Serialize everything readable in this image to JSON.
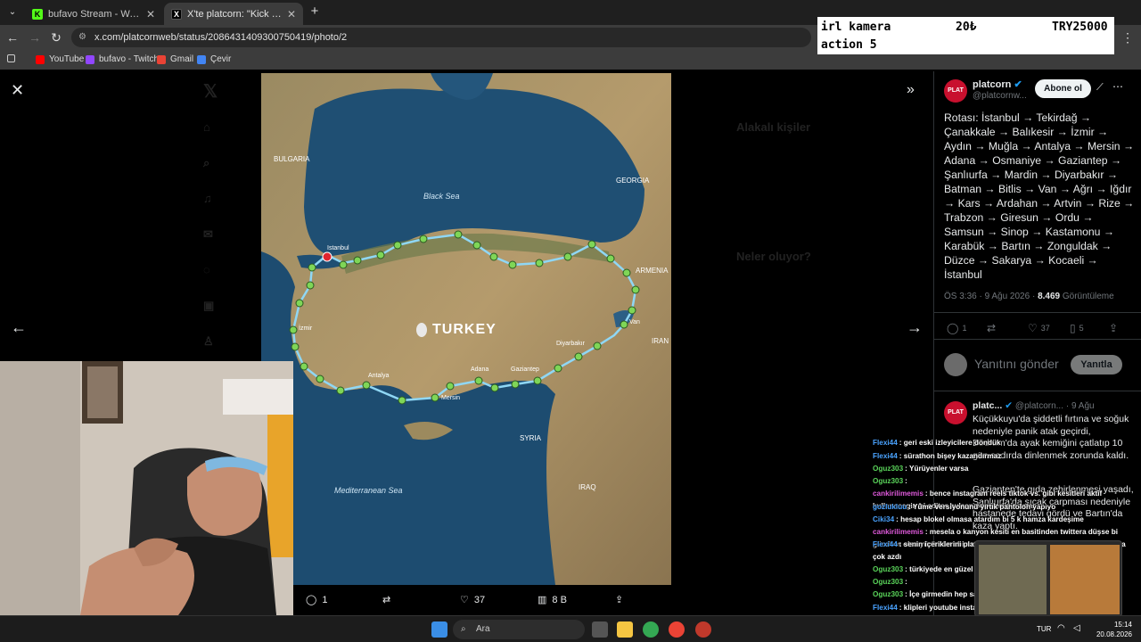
{
  "browser": {
    "tabs": [
      {
        "title": "bufavo Stream - Watch Live on",
        "favicon": "kick-icon",
        "active": false
      },
      {
        "title": "X'te platcorn: \"Kick yayıncısı Bu",
        "favicon": "x-icon",
        "active": true
      }
    ],
    "url": "x.com/platcornweb/status/2086431409300750419/photo/2",
    "bookmarks": [
      "YouTube",
      "bufavo - Twitch",
      "Gmail",
      "Çevir"
    ]
  },
  "stream_overlay": {
    "label_line1": "irl kamera",
    "label_line2": "action 5",
    "price": "20₺",
    "goal": "TRY25000"
  },
  "map": {
    "country": "TURKEY",
    "seas": [
      "Black Sea",
      "Mediterranean Sea"
    ],
    "neighbors": [
      "BULGARIA",
      "GEORGIA",
      "ARMENIA",
      "IRAN",
      "SYRIA",
      "IRAQ"
    ],
    "cities": [
      "Istanbul",
      "İzmir",
      "Antalya",
      "Mersin",
      "Adana",
      "Gaziantep",
      "Diyarbakır",
      "Van"
    ]
  },
  "photo_actions": {
    "replies": "1",
    "likes": "37",
    "views": "8 B"
  },
  "tweet": {
    "author": "platcorn",
    "handle": "@platcornw...",
    "follow_label": "Abone ol",
    "text": "Rotası: İstanbul → Tekirdağ → Çanakkale → Balıkesir → İzmir → Aydın → Muğla → Antalya → Mersin → Adana → Osmaniye → Gaziantep → Şanlıurfa → Mardin → Diyarbakır → Batman → Bitlis → Van → Ağrı → Iğdır → Kars → Ardahan → Artvin → Rize → Trabzon → Giresun → Ordu → Samsun → Sinop → Kastamonu → Karabük → Bartın → Zonguldak → Düzce → Sakarya → Kocaeli → İstanbul",
    "time": "ÖS 3:36 · 9 Ağu 2026 ·",
    "views": "8.469",
    "views_label": "Görüntüleme",
    "replies": "1",
    "likes": "37",
    "bookmarks": "5",
    "reply_placeholder": "Yanıtını gönder",
    "reply_button": "Yanıtla"
  },
  "reply_tweet": {
    "author": "platc...",
    "handle": "@platcorn...",
    "date": "· 9 Ağu",
    "text1": "Küçükkuyu'da şiddetli fırtına ve soğuk nedeniyle panik atak geçirdi, Bodrum'da ayak kemiğini çatlatıp 10 gün sadırda dinlenmek zorunda kaldı.",
    "text2": "Gaziantep'te gıda zehirlenmesi yaşadı, Şanlıurfa'da sıcak çarpması nedeniyle hastanede tedavi gördü ve Bartın'da kaza yaptı."
  },
  "chat": [
    {
      "user": "Flexi44",
      "msg": ": geri eski izleyicilere döndük",
      "color": "#4aa3ff"
    },
    {
      "user": "Flexi44",
      "msg": ": sürathon bişey kazandırmaz",
      "color": "#4aa3ff"
    },
    {
      "user": "Oguz303",
      "msg": ": Yürüyenler varsa",
      "color": "#5ad45a"
    },
    {
      "user": "Oguz303",
      "msg": ":",
      "color": "#5ad45a"
    },
    {
      "user": "cankirilimemis",
      "msg": ": bence instagram reels tiktok vs. gibi kesitleri aktif kullanacagin bi editor bulsan popülerligin artar",
      "color": "#e05adc"
    },
    {
      "user": "gozlukluu",
      "msg": ": Yüme versiyonunu yırtık pantolon yapıyo",
      "color": "#4aa3ff"
    },
    {
      "user": "Ciki34",
      "msg": ": hesap blokel olmasa atardım bi 5 k hamza kardeşime",
      "color": "#4aa3ff"
    },
    {
      "user": "cankirilimemis",
      "msg": ": mesela o kanyon kesiti en basitinden twittera düşse bi gündem olsa yürürsün abi mesela",
      "color": "#e05adc"
    },
    {
      "user": "Flexi44",
      "msg": ": senin içeriklerini platcorn ve onlydrama paylaştı sadece onlarda çok azdı",
      "color": "#4aa3ff"
    },
    {
      "user": "Oguz303",
      "msg": ": türkiyede en güzel güzergah aslında",
      "color": "#5ad45a"
    },
    {
      "user": "Oguz303",
      "msg": ":",
      "color": "#5ad45a"
    },
    {
      "user": "Oguz303",
      "msg": ": İçe girmedin hep sahil boyu",
      "color": "#5ad45a"
    },
    {
      "user": "Flexi44",
      "msg": ": klipleri youtube insta atan yoktu videolar sıfırdı",
      "color": "#4aa3ff"
    }
  ],
  "taskbar": {
    "search": "Ara",
    "lang": "TUR",
    "time": "15:14",
    "date": "20.08.2026"
  }
}
